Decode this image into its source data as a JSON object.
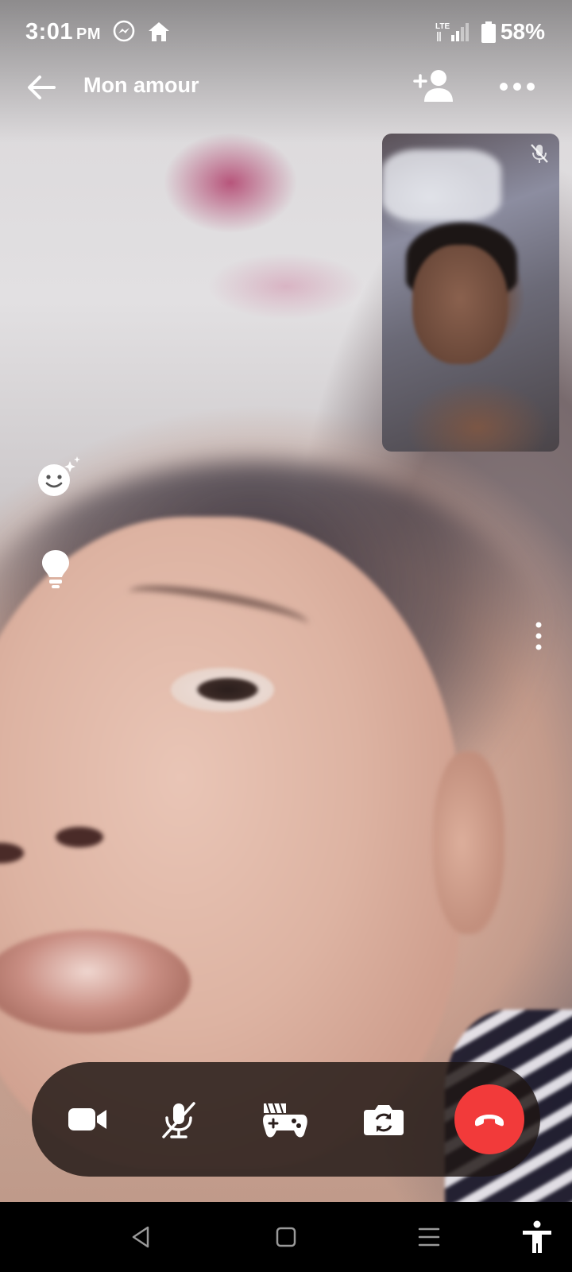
{
  "status_bar": {
    "time": "3:01",
    "ampm": "PM",
    "battery": "58%",
    "network": "LTE"
  },
  "call": {
    "contact_name": "Mon amour"
  },
  "icons": {
    "back": "back-arrow-icon",
    "add_person": "add-person-icon",
    "more": "more-horizontal-icon",
    "mute": "mic-off-icon",
    "effects": "effects-smiley-icon",
    "tips": "lightbulb-icon",
    "video": "video-camera-icon",
    "games": "games-controller-icon",
    "flip_camera": "flip-camera-icon",
    "end_call": "end-call-icon"
  },
  "colors": {
    "end_call": "#f23a3a",
    "control_bar": "#1e1614"
  }
}
